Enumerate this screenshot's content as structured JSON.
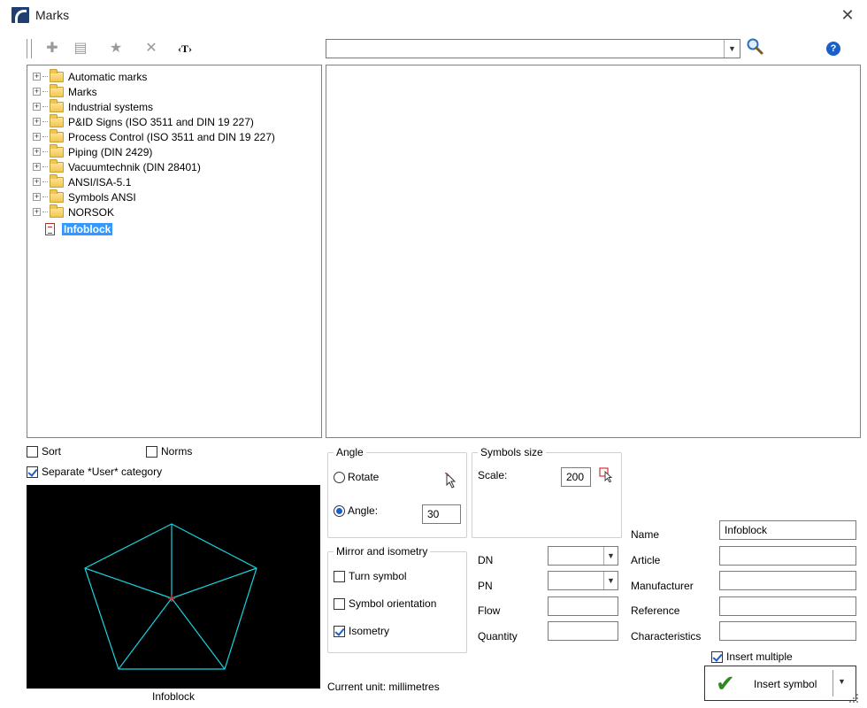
{
  "window": {
    "title": "Marks",
    "close_glyph": "✕"
  },
  "toolbar": {
    "buttons": [
      {
        "name": "add-icon",
        "glyph": "✚"
      },
      {
        "name": "properties-icon",
        "glyph": "▤"
      },
      {
        "name": "star-icon",
        "glyph": "★"
      },
      {
        "name": "delete-icon",
        "glyph": "✕"
      },
      {
        "name": "text-icon",
        "glyph": "‹T›"
      }
    ],
    "search_value": "",
    "help_glyph": "?"
  },
  "tree": {
    "items": [
      {
        "label": "Automatic marks",
        "type": "folder"
      },
      {
        "label": "Marks",
        "type": "folder"
      },
      {
        "label": "Industrial systems",
        "type": "folder"
      },
      {
        "label": "P&ID Signs (ISO 3511 and DIN 19 227)",
        "type": "folder"
      },
      {
        "label": "Process Control (ISO 3511 and DIN 19 227)",
        "type": "folder"
      },
      {
        "label": "Piping (DIN 2429)",
        "type": "folder"
      },
      {
        "label": "Vacuumtechnik (DIN 28401)",
        "type": "folder"
      },
      {
        "label": "ANSI/ISA-5.1",
        "type": "folder"
      },
      {
        "label": "Symbols ANSI",
        "type": "folder"
      },
      {
        "label": "NORSOK",
        "type": "folder"
      },
      {
        "label": "Infoblock",
        "type": "document",
        "selected": true
      }
    ]
  },
  "options": {
    "sort_label": "Sort",
    "sort_checked": false,
    "norms_label": "Norms",
    "norms_checked": false,
    "separate_user_label": "Separate *User* category",
    "separate_user_checked": true
  },
  "symbol_preview": {
    "caption": "Infoblock",
    "line_color": "#19d3e0",
    "center_color": "#d0303a"
  },
  "angle": {
    "title": "Angle",
    "rotate_label": "Rotate",
    "angle_label": "Angle:",
    "angle_value": "30",
    "selected": "angle"
  },
  "symbols_size": {
    "title": "Symbols size",
    "scale_label": "Scale:",
    "scale_value": "200"
  },
  "mirror": {
    "title": "Mirror and isometry",
    "turn_label": "Turn symbol",
    "turn_checked": false,
    "orientation_label": "Symbol orientation",
    "orientation_checked": false,
    "isometry_label": "Isometry",
    "isometry_checked": true
  },
  "pipe_fields": {
    "dn_label": "DN",
    "dn_value": "",
    "pn_label": "PN",
    "pn_value": "",
    "flow_label": "Flow",
    "flow_value": "",
    "quantity_label": "Quantity",
    "quantity_value": ""
  },
  "attributes": {
    "name_label": "Name",
    "name_value": "Infoblock",
    "article_label": "Article",
    "article_value": "",
    "manufacturer_label": "Manufacturer",
    "manufacturer_value": "",
    "reference_label": "Reference",
    "reference_value": "",
    "characteristics_label": "Characteristics",
    "characteristics_value": ""
  },
  "insert": {
    "multiple_label": "Insert multiple",
    "multiple_checked": true,
    "button_label": "Insert symbol"
  },
  "status": {
    "unit_text": "Current unit: millimetres"
  },
  "colors": {
    "accent": "#1a5fc8",
    "selection": "#3399ff",
    "insert_check": "#2f8a1f"
  }
}
